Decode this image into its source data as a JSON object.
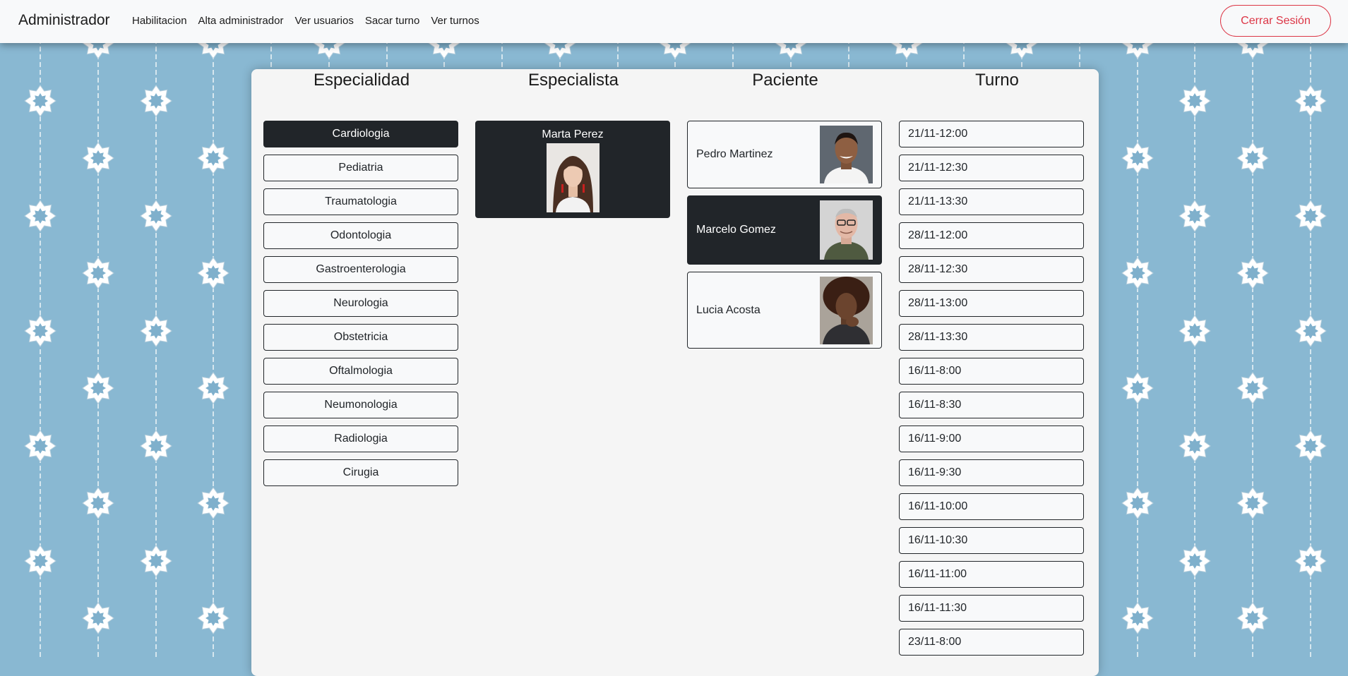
{
  "navbar": {
    "brand": "Administrador",
    "links": [
      "Habilitacion",
      "Alta administrador",
      "Ver usuarios",
      "Sacar turno",
      "Ver turnos"
    ],
    "logout_label": "Cerrar Sesión",
    "logout_color": "#dc3545"
  },
  "columns": {
    "especialidad": "Especialidad",
    "especialista": "Especialista",
    "paciente": "Paciente",
    "turno": "Turno"
  },
  "especialidades": [
    "Cardiologia",
    "Pediatria",
    "Traumatologia",
    "Odontologia",
    "Gastroenterologia",
    "Neurologia",
    "Obstetricia",
    "Oftalmologia",
    "Neumonologia",
    "Radiologia",
    "Cirugia"
  ],
  "selected_especialidad": "Cardiologia",
  "especialistas": [
    {
      "name": "Marta Perez",
      "selected": true
    }
  ],
  "pacientes": [
    {
      "name": "Pedro Martinez",
      "selected": false
    },
    {
      "name": "Marcelo Gomez",
      "selected": true
    },
    {
      "name": "Lucia Acosta",
      "selected": false
    }
  ],
  "turnos": [
    "21/11-12:00",
    "21/11-12:30",
    "21/11-13:30",
    "28/11-12:00",
    "28/11-12:30",
    "28/11-13:00",
    "28/11-13:30",
    "16/11-8:00",
    "16/11-8:30",
    "16/11-9:00",
    "16/11-9:30",
    "16/11-10:00",
    "16/11-10:30",
    "16/11-11:00",
    "16/11-11:30",
    "23/11-8:00"
  ],
  "colors": {
    "background": "#89b8d2",
    "panel": "#f5f5f5",
    "selected": "#212529"
  }
}
